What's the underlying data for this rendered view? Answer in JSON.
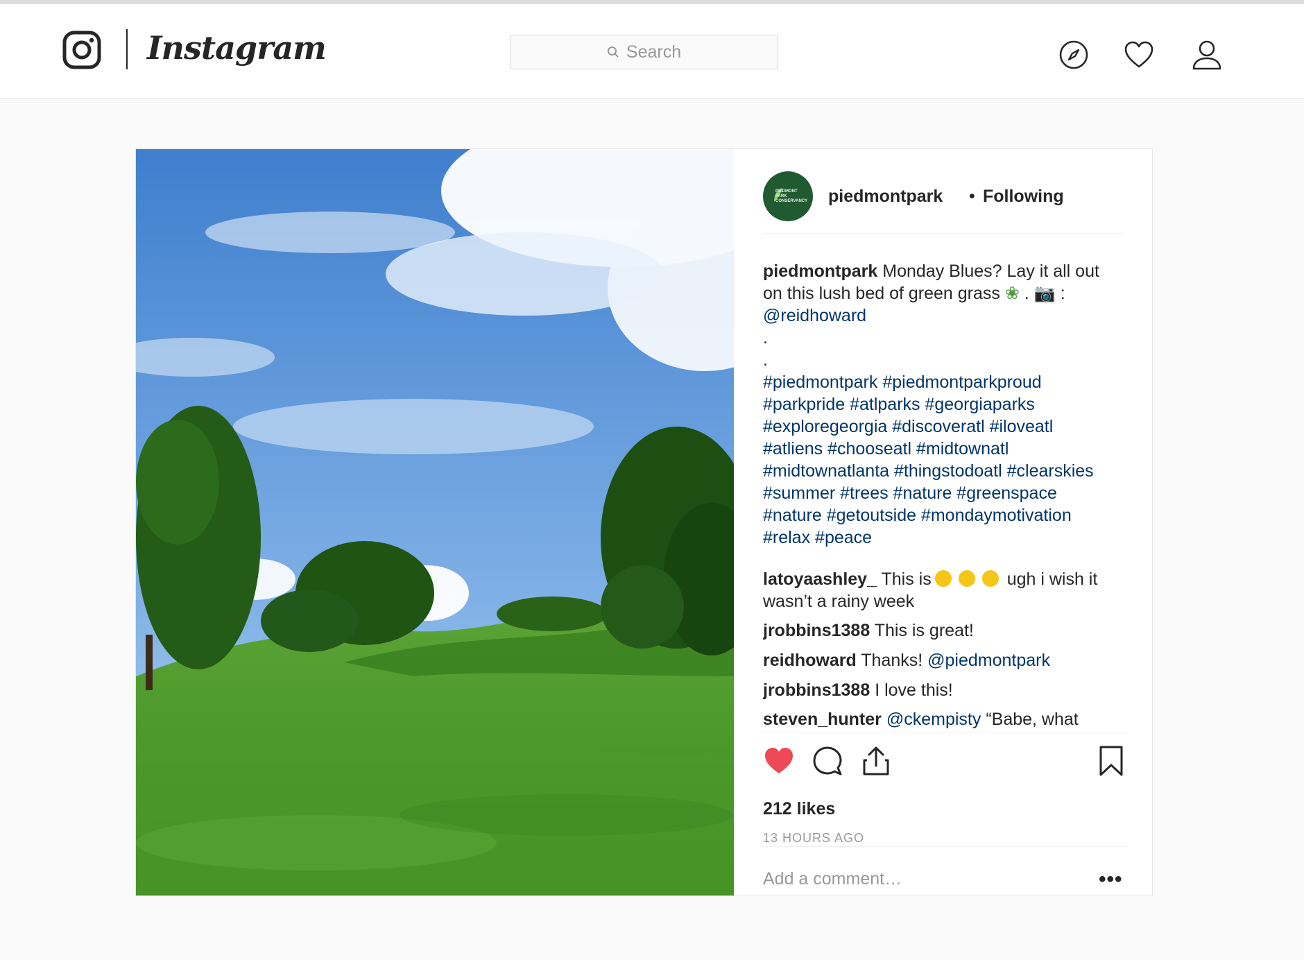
{
  "header": {
    "brand": "Instagram",
    "search_placeholder": "Search"
  },
  "post": {
    "username": "piedmontpark",
    "separator": "•",
    "follow_status": "Following",
    "avatar_text": "PIEDMONT PARK CONSERVANCY",
    "caption": {
      "username": "piedmontpark",
      "line1": "Monday Blues? Lay it all out",
      "line2": "on this lush bed of green grass",
      "line2_tail": ". 📷 :",
      "mention": "@reidhoward",
      "dot1": ".",
      "dot2": ".",
      "hashtag_lines": [
        "#piedmontpark #piedmontparkproud",
        "#parkpride #atlparks #georgiaparks",
        "#exploregeorgia #discoveratl #iloveatl",
        "#atliens #chooseatl #midtownatl",
        "#midtownatlanta #thingstodoatl #clearskies",
        "#summer #trees #nature #greenspace",
        "#nature #getoutside #mondaymotivation",
        "#relax #peace"
      ]
    },
    "comments": [
      {
        "username": "latoyaashley_",
        "text_a": "This is",
        "text_b": "ugh i wish it",
        "text_c": "wasn’t a rainy week"
      },
      {
        "username": "jrobbins1388",
        "text": "This is great!"
      },
      {
        "username": "reidhoward",
        "text": "Thanks!",
        "mention": "@piedmontpark"
      },
      {
        "username": "jrobbins1388",
        "text": "I love this!"
      },
      {
        "username": "steven_hunter",
        "mention": "@ckempisty",
        "text": "“Babe, what"
      }
    ],
    "likes": "212 likes",
    "time": "13 HOURS AGO",
    "add_comment_placeholder": "Add a comment…",
    "more": "•••",
    "colors": {
      "like_red": "#ed4956",
      "link": "#003569",
      "avatar_green": "#1f5a31"
    }
  }
}
